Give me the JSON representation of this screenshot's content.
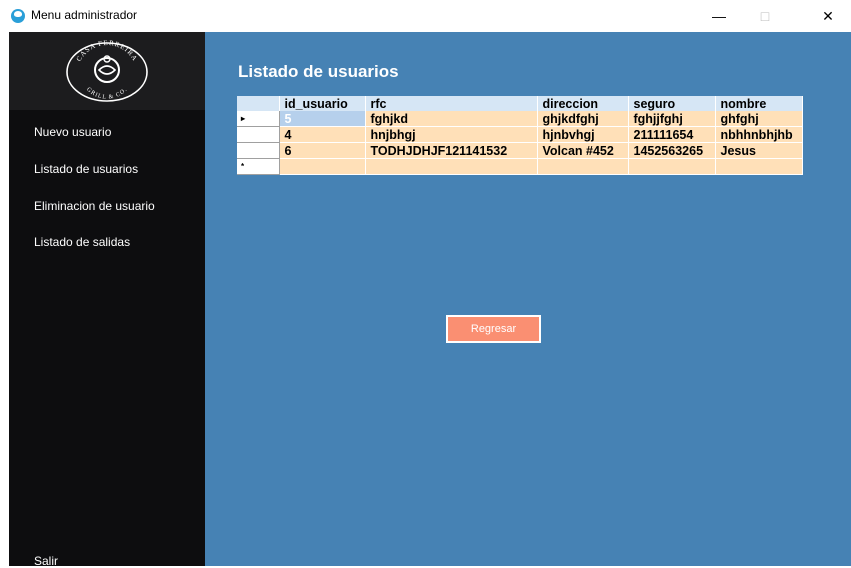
{
  "window": {
    "title": "Menu administrador",
    "controls": {
      "minimize": "—",
      "maximize": "□",
      "close": "✕"
    }
  },
  "sidebar": {
    "logo": {
      "top_text": "CASA FERREIRA",
      "bottom_text": "GRILL & CO."
    },
    "items": [
      {
        "label": "Nuevo usuario"
      },
      {
        "label": "Listado de usuarios"
      },
      {
        "label": "Eliminacion de usuario"
      },
      {
        "label": "Listado de salidas"
      }
    ],
    "exit_label": "Salir"
  },
  "main": {
    "heading": "Listado de usuarios",
    "table": {
      "columns": [
        "id_usuario",
        "rfc",
        "direccion",
        "seguro",
        "nombre"
      ],
      "rows": [
        {
          "indicator": "▸",
          "cells": [
            "5",
            "fghjkd",
            "ghjkdfghj",
            "fghjjfghj",
            "ghfghj"
          ]
        },
        {
          "indicator": "",
          "cells": [
            "4",
            "hnjbhgj",
            "hjnbvhgj",
            "211111654",
            "nbhhnbhjhb"
          ]
        },
        {
          "indicator": "",
          "cells": [
            "6",
            "TODHJDHJF121141532",
            "Volcan #452",
            "1452563265",
            "Jesus"
          ]
        }
      ],
      "new_row_indicator": "*"
    },
    "back_button": "Regresar"
  },
  "colors": {
    "main_bg": "#4682b4",
    "sidebar_bg": "#0d0d0f",
    "header_bg": "#d6e6f5",
    "row_bg": "#ffe0b8",
    "selected_cell": "#b6d0ec",
    "button_bg": "#fa8f72"
  }
}
